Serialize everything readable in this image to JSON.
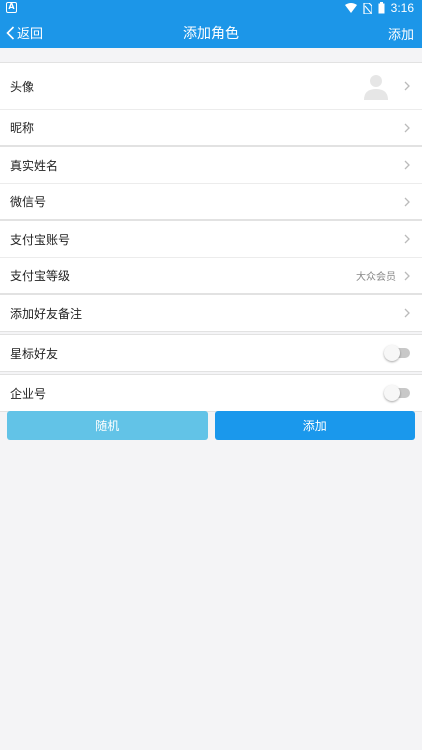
{
  "statusbar": {
    "time": "3:16",
    "app_icon_letter": "A"
  },
  "nav": {
    "back_label": "返回",
    "title": "添加角色",
    "add_label": "添加"
  },
  "rows": {
    "avatar": "头像",
    "nickname": "昵称",
    "realname": "真实姓名",
    "wechat": "微信号",
    "alipay_account": "支付宝账号",
    "alipay_level": "支付宝等级",
    "alipay_level_value": "大众会员",
    "friend_note": "添加好友备注",
    "star_friend": "星标好友",
    "enterprise": "企业号"
  },
  "toggles": {
    "star_friend": false,
    "enterprise": false
  },
  "buttons": {
    "random": "随机",
    "add": "添加"
  },
  "colors": {
    "primary": "#1c96e8",
    "random_button": "#62c3e7",
    "add_button": "#1a98ec"
  }
}
